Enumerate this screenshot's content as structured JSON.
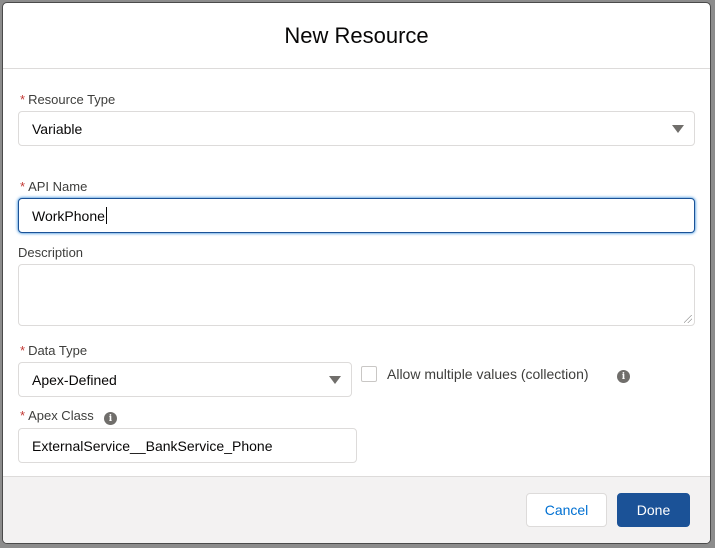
{
  "modal": {
    "title": "New Resource"
  },
  "fields": {
    "resource_type": {
      "label": "Resource Type",
      "required": "*",
      "value": "Variable"
    },
    "api_name": {
      "label": "API Name",
      "required": "*",
      "value": "WorkPhone"
    },
    "description": {
      "label": "Description",
      "value": ""
    },
    "data_type": {
      "label": "Data Type",
      "required": "*",
      "value": "Apex-Defined"
    },
    "allow_multiple": {
      "label": "Allow multiple values (collection)",
      "checked": false
    },
    "apex_class": {
      "label": "Apex Class",
      "required": "*",
      "value": "ExternalService__BankService_Phone"
    }
  },
  "icons": {
    "info": "i"
  },
  "footer": {
    "cancel_label": "Cancel",
    "done_label": "Done"
  },
  "colors": {
    "brand": "#1b5297",
    "required": "#c23934",
    "link": "#0070d2"
  }
}
